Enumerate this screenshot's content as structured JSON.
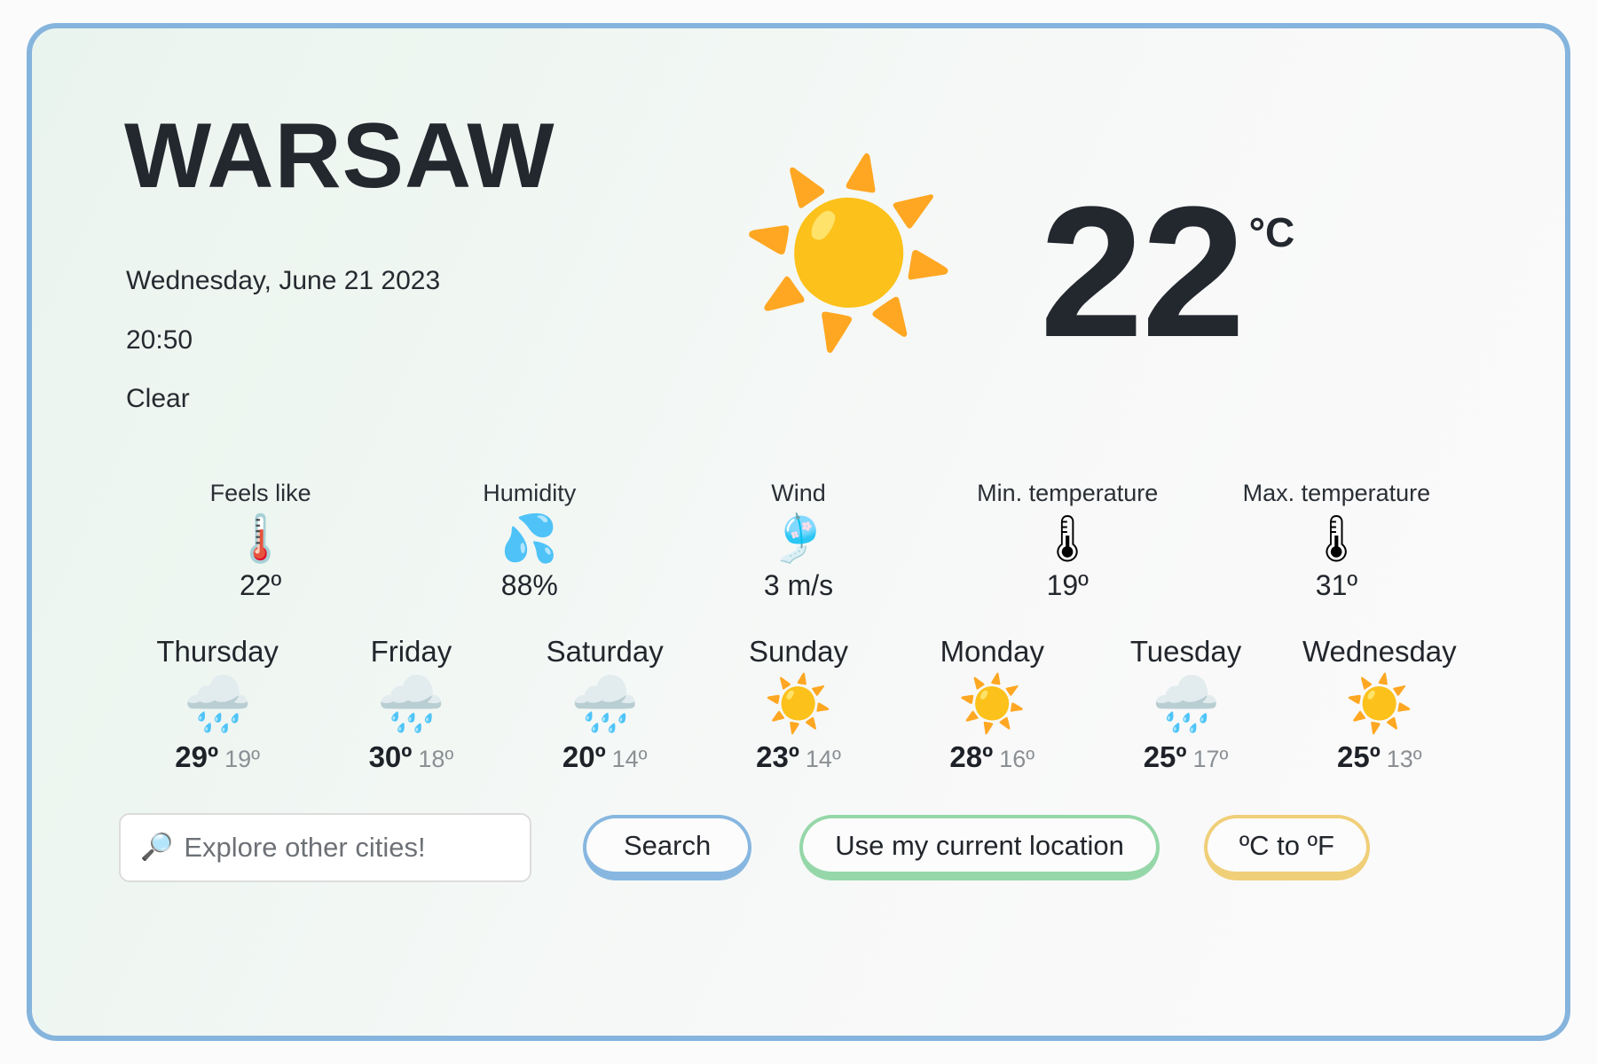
{
  "card": {
    "border_color": "#85b4dd",
    "background_from": "#eaf4ee",
    "background_to": "#fafafa"
  },
  "hero": {
    "city": "WARSAW",
    "date": "Wednesday, June 21 2023",
    "time": "20:50",
    "condition": "Clear",
    "condition_icon": "☀️",
    "temperature": "22",
    "unit": "°C"
  },
  "metrics": [
    {
      "label": "Feels like",
      "icon": "🌡️",
      "icon_name": "thermometer-icon",
      "value": "22º"
    },
    {
      "label": "Humidity",
      "icon": "💦",
      "icon_name": "water-droplets-icon",
      "value": "88%"
    },
    {
      "label": "Wind",
      "icon": "🎐",
      "icon_name": "windsock-icon",
      "value": "3 m/s"
    },
    {
      "label": "Min. temperature",
      "icon": "🌡",
      "icon_name": "cold-thermometer-icon",
      "value": "19º"
    },
    {
      "label": "Max. temperature",
      "icon": "🌡",
      "icon_name": "hot-thermometer-icon",
      "value": "31º"
    }
  ],
  "forecast": [
    {
      "day": "Thursday",
      "icon": "🌧️",
      "icon_name": "rain-cloud-icon",
      "high": "29º",
      "low": "19º"
    },
    {
      "day": "Friday",
      "icon": "🌧️",
      "icon_name": "rain-cloud-icon",
      "high": "30º",
      "low": "18º"
    },
    {
      "day": "Saturday",
      "icon": "🌧️",
      "icon_name": "rain-cloud-icon",
      "high": "20º",
      "low": "14º"
    },
    {
      "day": "Sunday",
      "icon": "☀️",
      "icon_name": "sun-icon",
      "high": "23º",
      "low": "14º"
    },
    {
      "day": "Monday",
      "icon": "☀️",
      "icon_name": "sun-icon",
      "high": "28º",
      "low": "16º"
    },
    {
      "day": "Tuesday",
      "icon": "🌧️",
      "icon_name": "rain-cloud-icon",
      "high": "25º",
      "low": "17º"
    },
    {
      "day": "Wednesday",
      "icon": "☀️",
      "icon_name": "sun-icon",
      "high": "25º",
      "low": "13º"
    }
  ],
  "controls": {
    "search_icon": "🔎",
    "search_placeholder": "Explore other cities!",
    "search_value": "",
    "search_button": "Search",
    "location_button": "Use my current location",
    "convert_button": "ºC to ºF",
    "search_border_color": "#87b7e0",
    "location_border_color": "#95d7a8",
    "convert_border_color": "#f0cf79"
  }
}
